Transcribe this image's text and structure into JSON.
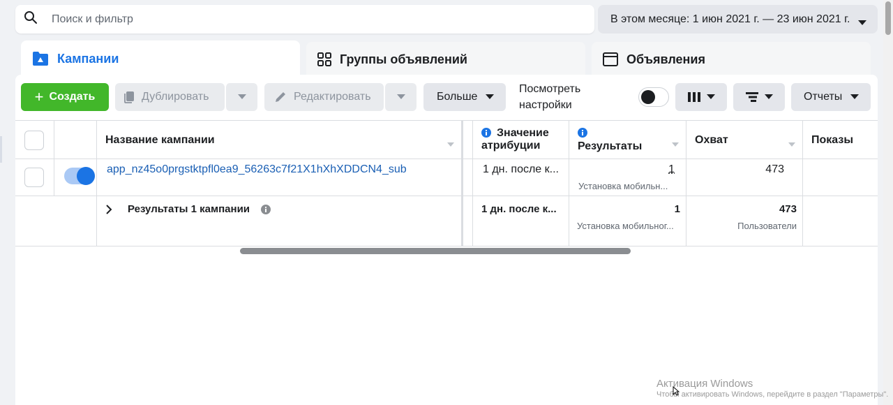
{
  "search": {
    "placeholder": "Поиск и фильтр"
  },
  "date_range": {
    "label": "В этом месяце: 1 июн 2021 г. — 23 июн 2021 г."
  },
  "tabs": [
    {
      "label": "Кампании"
    },
    {
      "label": "Группы объявлений"
    },
    {
      "label": "Объявления"
    }
  ],
  "toolbar": {
    "create_label": "Создать",
    "duplicate_label": "Дублировать",
    "edit_label": "Редактировать",
    "more_label": "Больше",
    "view_settings_label": "Посмотреть настройки",
    "reports_label": "Отчеты"
  },
  "table": {
    "headers": {
      "name": "Название кампании",
      "attribution": "Значение атрибуции",
      "results": "Результаты",
      "reach": "Охват",
      "impressions": "Показы"
    },
    "rows": [
      {
        "name": "app_nz45o0prgstktpfl0ea9_56263c7f21X1hXhXDDCN4_sub",
        "attribution": "1 дн. после к...",
        "results": "1",
        "results_sub": "Установка мобильн...",
        "reach": "473"
      }
    ],
    "summary": {
      "label": "Результаты 1 кампании",
      "attribution": "1 дн. после к...",
      "results": "1",
      "results_sub": "Установка мобильног...",
      "reach": "473",
      "reach_sub": "Пользователи"
    }
  },
  "watermark": {
    "title": "Активация Windows",
    "subtitle": "Чтобы активировать Windows, перейдите в раздел \"Параметры\"."
  },
  "colors": {
    "accent": "#1b74e4",
    "create": "#42b72a",
    "link": "#1a5fb4"
  }
}
